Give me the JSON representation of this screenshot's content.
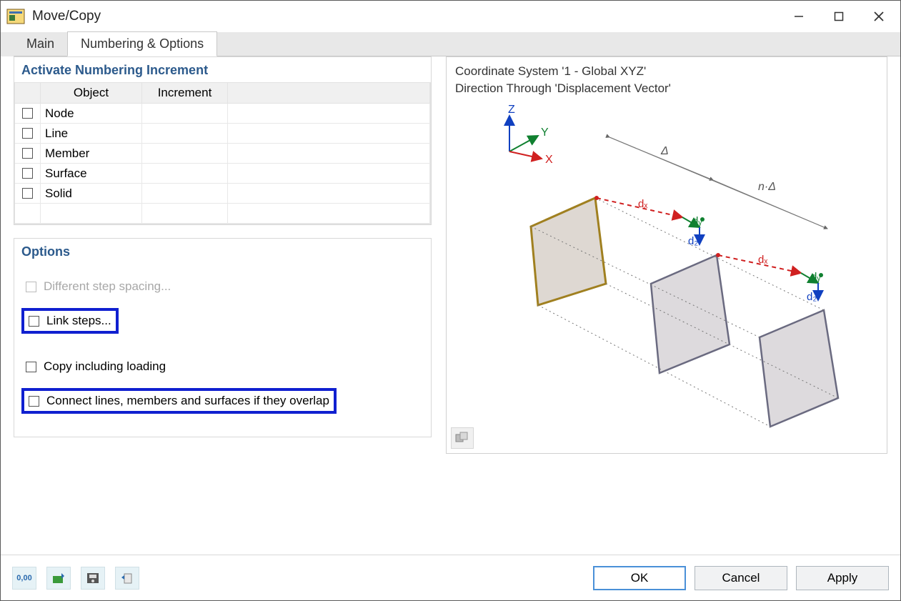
{
  "window": {
    "title": "Move/Copy"
  },
  "tabs": {
    "main": "Main",
    "numbering": "Numbering & Options"
  },
  "panel_numbering": {
    "title": "Activate Numbering Increment",
    "col_object": "Object",
    "col_increment": "Increment",
    "rows": {
      "node": "Node",
      "line": "Line",
      "member": "Member",
      "surface": "Surface",
      "solid": "Solid"
    }
  },
  "panel_options": {
    "title": "Options",
    "diff_step": "Different step spacing...",
    "link_steps": "Link steps...",
    "copy_loading": "Copy including loading",
    "connect_overlap": "Connect lines, members and surfaces if they overlap"
  },
  "preview": {
    "line1": "Coordinate System '1 - Global XYZ'",
    "line2": "Direction Through 'Displacement Vector'",
    "axis_z": "Z",
    "axis_y": "Y",
    "axis_x": "X",
    "lbl_delta": "Δ",
    "lbl_ndelta": "n·Δ",
    "lbl_dx": "dₓ",
    "lbl_dy": "dᵧ",
    "lbl_dz": "d₂"
  },
  "buttons": {
    "ok": "OK",
    "cancel": "Cancel",
    "apply": "Apply"
  }
}
